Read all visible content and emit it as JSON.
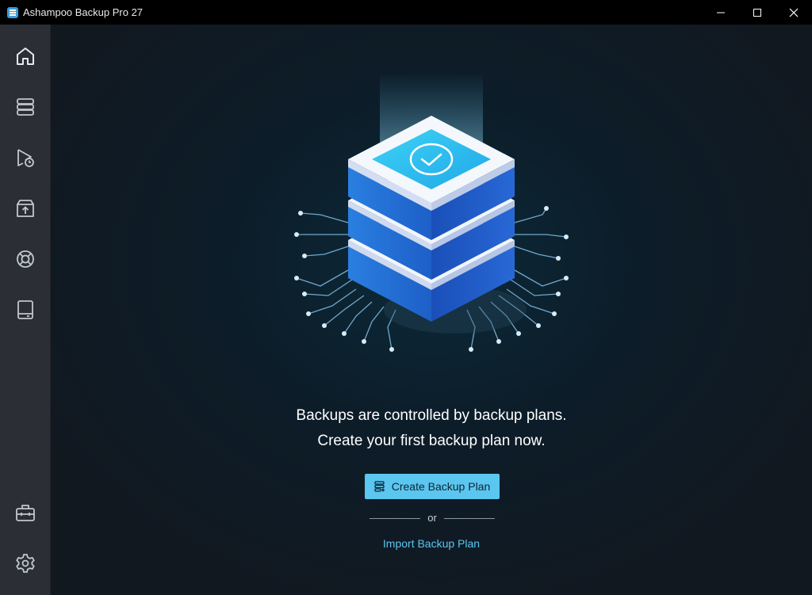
{
  "window": {
    "title": "Ashampoo Backup Pro 27",
    "controls": [
      "minimize",
      "maximize",
      "close"
    ]
  },
  "sidebar": {
    "top_items": [
      {
        "icon": "home-icon"
      },
      {
        "icon": "backup-plans-icon"
      },
      {
        "icon": "run-schedule-icon"
      },
      {
        "icon": "restore-box-icon"
      },
      {
        "icon": "rescue-lifebuoy-icon"
      },
      {
        "icon": "drive-icon"
      }
    ],
    "bottom_items": [
      {
        "icon": "toolbox-icon"
      },
      {
        "icon": "gear-icon"
      }
    ]
  },
  "main": {
    "message_line1": "Backups are controlled by backup plans.",
    "message_line2": "Create your first backup plan now.",
    "create_button_label": "Create Backup Plan",
    "or_text": "or",
    "import_link_label": "Import Backup Plan"
  },
  "colors": {
    "accent": "#5bc6f0",
    "sidebar_bg": "#2b2f35",
    "main_bg": "#0c1d29",
    "titlebar_bg": "#000000"
  }
}
